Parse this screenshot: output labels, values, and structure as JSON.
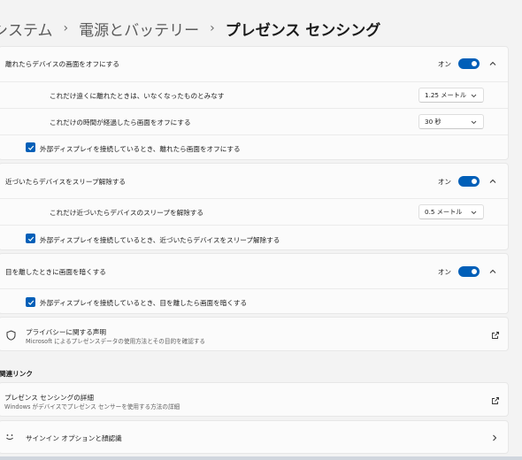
{
  "breadcrumb": {
    "level1": "システム",
    "level2": "電源とバッテリー",
    "current": "プレゼンス センシング"
  },
  "wake_off": {
    "title": "離れたらデバイスの画面をオフにする",
    "toggle_label": "オン",
    "distance_label": "これだけ遠くに離れたときは、いなくなったものとみなす",
    "distance_value": "1.25 メートル",
    "time_label": "これだけの時間が経過したら画面をオフにする",
    "time_value": "30 秒",
    "external_label": "外部ディスプレイを接続しているとき、離れたら画面をオフにする"
  },
  "wake_on": {
    "title": "近づいたらデバイスをスリープ解除する",
    "toggle_label": "オン",
    "distance_label": "これだけ近づいたらデバイスのスリープを解除する",
    "distance_value": "0.5 メートル",
    "external_label": "外部ディスプレイを接続しているとき、近づいたらデバイスをスリープ解除する"
  },
  "dim": {
    "title": "目を離したときに画面を暗くする",
    "toggle_label": "オン",
    "external_label": "外部ディスプレイを接続しているとき、目を離したら画面を暗くする"
  },
  "privacy": {
    "title": "プライバシーに関する声明",
    "subtitle": "Microsoft によるプレゼンスデータの使用方法とその目的を確認する"
  },
  "related": {
    "heading": "関連リンク",
    "details_title": "プレゼンス センシングの詳細",
    "details_subtitle": "Windows がデバイスでプレゼンス センサーを使用する方法の詳細",
    "signin_title": "サインイン オプションと顔認識"
  },
  "colors": {
    "accent": "#005fb8",
    "background": "#f3f3f3",
    "card": "#fbfbfb"
  }
}
